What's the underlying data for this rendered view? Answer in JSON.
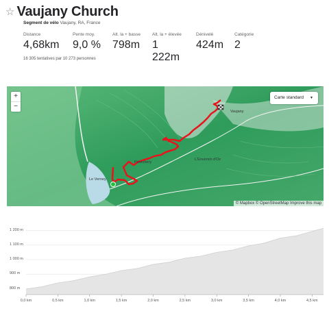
{
  "header": {
    "title": "Vaujany Church",
    "segment_type": "Segment de vélo",
    "location": "Vaujany, RA, France",
    "attempts": "16 305 tentatives par 10 273 personnes"
  },
  "stats": [
    {
      "label": "Distance",
      "value": "4,68km"
    },
    {
      "label": "Pente moy.",
      "value": "9,0 %"
    },
    {
      "label": "Alt. la + basse",
      "value": "798m"
    },
    {
      "label": "Alt. la + élevée",
      "value": "1 222m"
    },
    {
      "label": "Dénivelé",
      "value": "424m"
    },
    {
      "label": "Catégorie",
      "value": "2"
    }
  ],
  "map": {
    "zoom_in": "+",
    "zoom_out": "−",
    "map_type": "Carte standard",
    "places": [
      "Vaujany",
      "Pourchery",
      "L'Enversin d'Oz",
      "Le Verney"
    ],
    "attribution": "© Mapbox © OpenStreetMap Improve this map",
    "route_color": "#e8141b",
    "start_color": "#1fbf3a"
  },
  "chart_data": {
    "type": "area",
    "x": [
      0,
      0.25,
      0.5,
      0.75,
      1.0,
      1.25,
      1.5,
      1.75,
      2.0,
      2.25,
      2.5,
      2.75,
      3.0,
      3.25,
      3.5,
      3.75,
      4.0,
      4.25,
      4.5,
      4.68
    ],
    "y": [
      798,
      820,
      840,
      862,
      882,
      905,
      925,
      945,
      968,
      988,
      1010,
      1030,
      1050,
      1072,
      1095,
      1120,
      1148,
      1170,
      1195,
      1222
    ],
    "x_ticks": [
      "0,0 km",
      "0,5 km",
      "1,0 km",
      "1,5 km",
      "2,0 km",
      "2,5 km",
      "3,0 km",
      "3,5 km",
      "4,0 km",
      "4,5 km"
    ],
    "y_ticks": [
      "800 m",
      "900 m",
      "1 000 m",
      "1 100 m",
      "1 200 m"
    ],
    "xlim": [
      0,
      4.68
    ],
    "ylim": [
      760,
      1250
    ],
    "fill_color": "#e5e5e5",
    "grid": true
  }
}
